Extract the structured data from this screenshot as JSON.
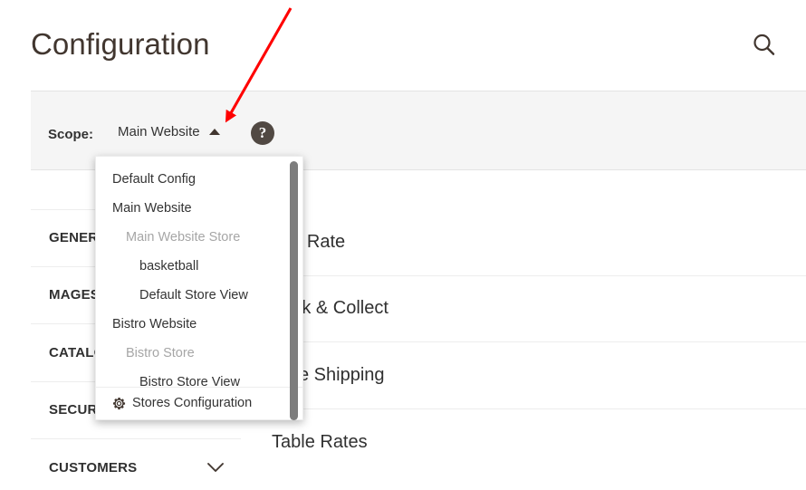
{
  "header": {
    "title": "Configuration",
    "search_icon": "search-icon"
  },
  "scope": {
    "label": "Scope:",
    "value": "Main Website",
    "caret_icon": "caret-up-icon",
    "help_icon": "question-mark-icon",
    "help_char": "?"
  },
  "scope_dropdown": {
    "items": [
      {
        "label": "Default Config",
        "level": "level-website"
      },
      {
        "label": "Main Website",
        "level": "level-website"
      },
      {
        "label": "Main Website Store",
        "level": "level-store"
      },
      {
        "label": "basketball",
        "level": "level-storeview"
      },
      {
        "label": "Default Store View",
        "level": "level-storeview"
      },
      {
        "label": "Bistro Website",
        "level": "level-website"
      },
      {
        "label": "Bistro Store",
        "level": "level-store"
      },
      {
        "label": "Bistro Store View",
        "level": "level-storeview"
      }
    ],
    "footer": {
      "label": "Stores Configuration",
      "icon": "gear-icon"
    }
  },
  "left_nav": {
    "items": [
      {
        "label": "GENERAL",
        "chevron": false
      },
      {
        "label": "MAGESTORE",
        "chevron": false
      },
      {
        "label": "CATALOG",
        "chevron": false
      },
      {
        "label": "SECURITY",
        "chevron": false
      },
      {
        "label": "CUSTOMERS",
        "chevron": true
      }
    ]
  },
  "content": {
    "rows": [
      {
        "title": "Flat Rate"
      },
      {
        "title": "Click & Collect"
      },
      {
        "title": "Free Shipping"
      },
      {
        "title": "Table Rates"
      }
    ]
  },
  "colors": {
    "accent_title": "#41362f",
    "scope_bar_bg": "#f5f5f5",
    "border": "#ededed",
    "help_circle": "#514943",
    "annotation": "#ff0000",
    "muted_text": "#a6a6a6"
  }
}
